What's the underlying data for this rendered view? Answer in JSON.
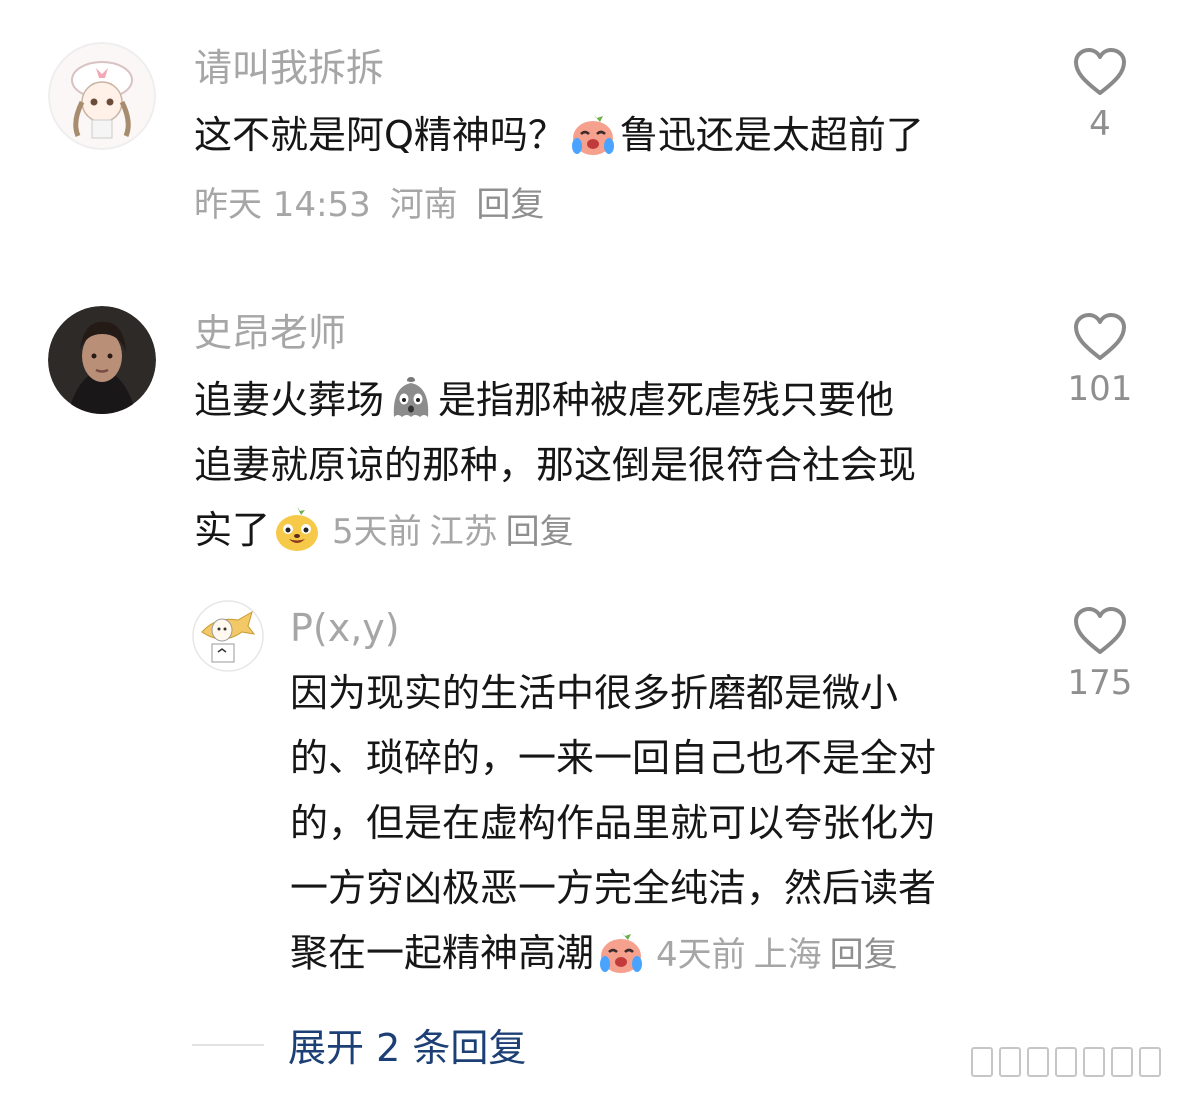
{
  "comments": [
    {
      "username": "请叫我拆拆",
      "text_lines": [
        "这不就是阿Q精神吗？",
        "鲁迅还是太超前了"
      ],
      "emoji": "crying-face-emoji",
      "meta": {
        "time": "昨天 14:53",
        "location": "河南",
        "reply": "回复"
      },
      "likes": "4"
    },
    {
      "username": "史昂老师",
      "text_lines": [
        "追妻火葬场",
        "是指那种被虐死虐残只要他",
        "追妻就原谅的那种，那这倒是很符合社会现",
        "实了"
      ],
      "emoji": [
        "ghost-face-emoji",
        "grinning-dog-emoji"
      ],
      "meta": {
        "time": "5天前",
        "location": "江苏",
        "reply": "回复"
      },
      "likes": "101"
    },
    {
      "username": "P(x,y)",
      "text_lines": [
        "因为现实的生活中很多折磨都是微小",
        "的、琐碎的，一来一回自己也不是全对",
        "的，但是在虚构作品里就可以夸张化为",
        "一方穷凶极恶一方完全纯洁，然后读者",
        "聚在一起精神高潮"
      ],
      "emoji": "crying-face-emoji",
      "meta": {
        "time": "4天前",
        "location": "上海",
        "reply": "回复"
      },
      "likes": "175"
    }
  ],
  "expand_replies": "展开 2 条回复",
  "colors": {
    "username": "#a6a6a6",
    "text": "#161616",
    "link": "#1c3f75",
    "icon": "#8a8a8a"
  }
}
